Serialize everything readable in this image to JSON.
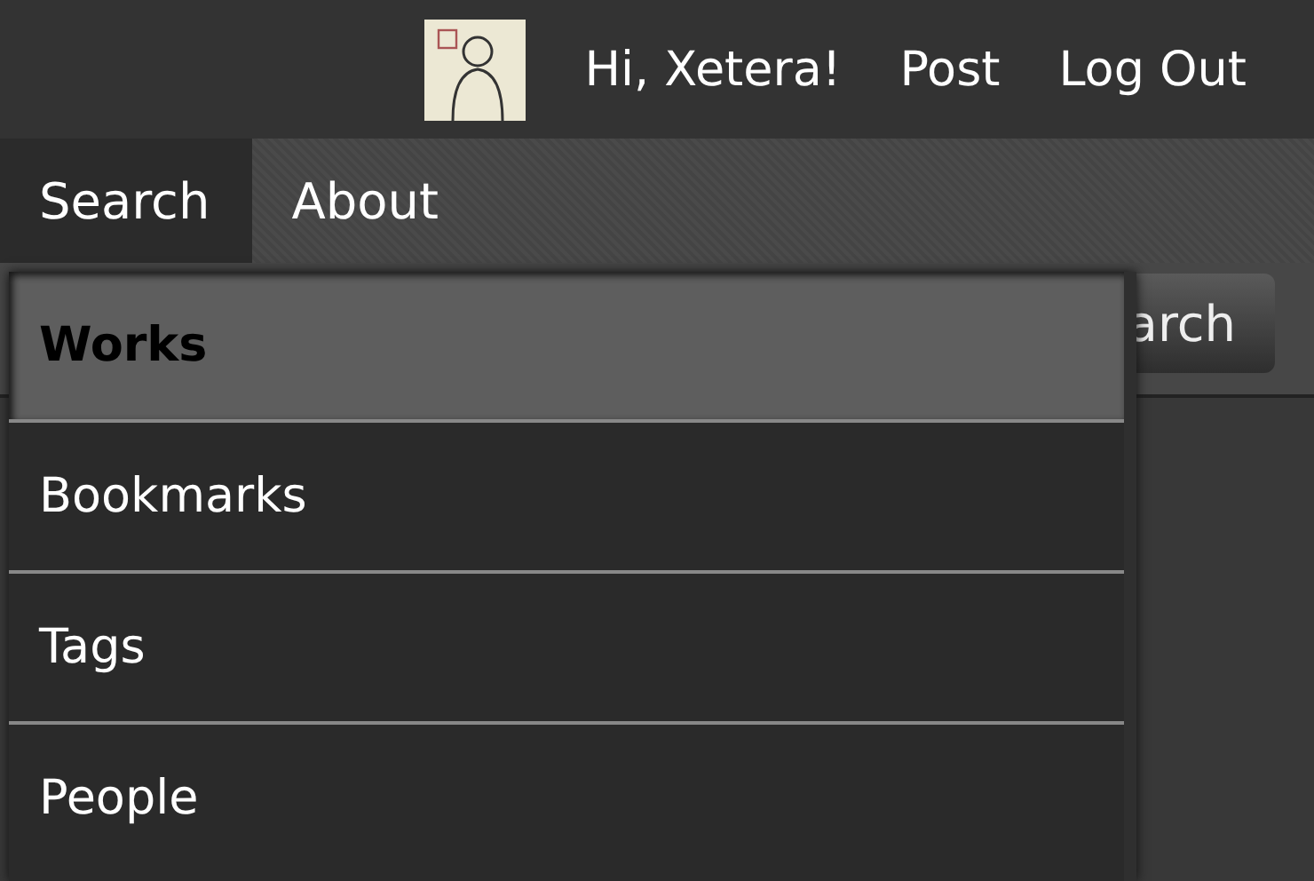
{
  "top_bar": {
    "greeting": "Hi, Xetera!",
    "links": [
      "Post",
      "Log Out"
    ]
  },
  "nav_tabs": [
    {
      "label": "Search",
      "selected": true
    },
    {
      "label": "About",
      "selected": false
    }
  ],
  "search_button": {
    "label": "arch"
  },
  "dropdown_menu": {
    "items": [
      {
        "label": "Works",
        "selected": true
      },
      {
        "label": "Bookmarks",
        "selected": false
      },
      {
        "label": "Tags",
        "selected": false
      },
      {
        "label": "People",
        "selected": false
      }
    ]
  }
}
